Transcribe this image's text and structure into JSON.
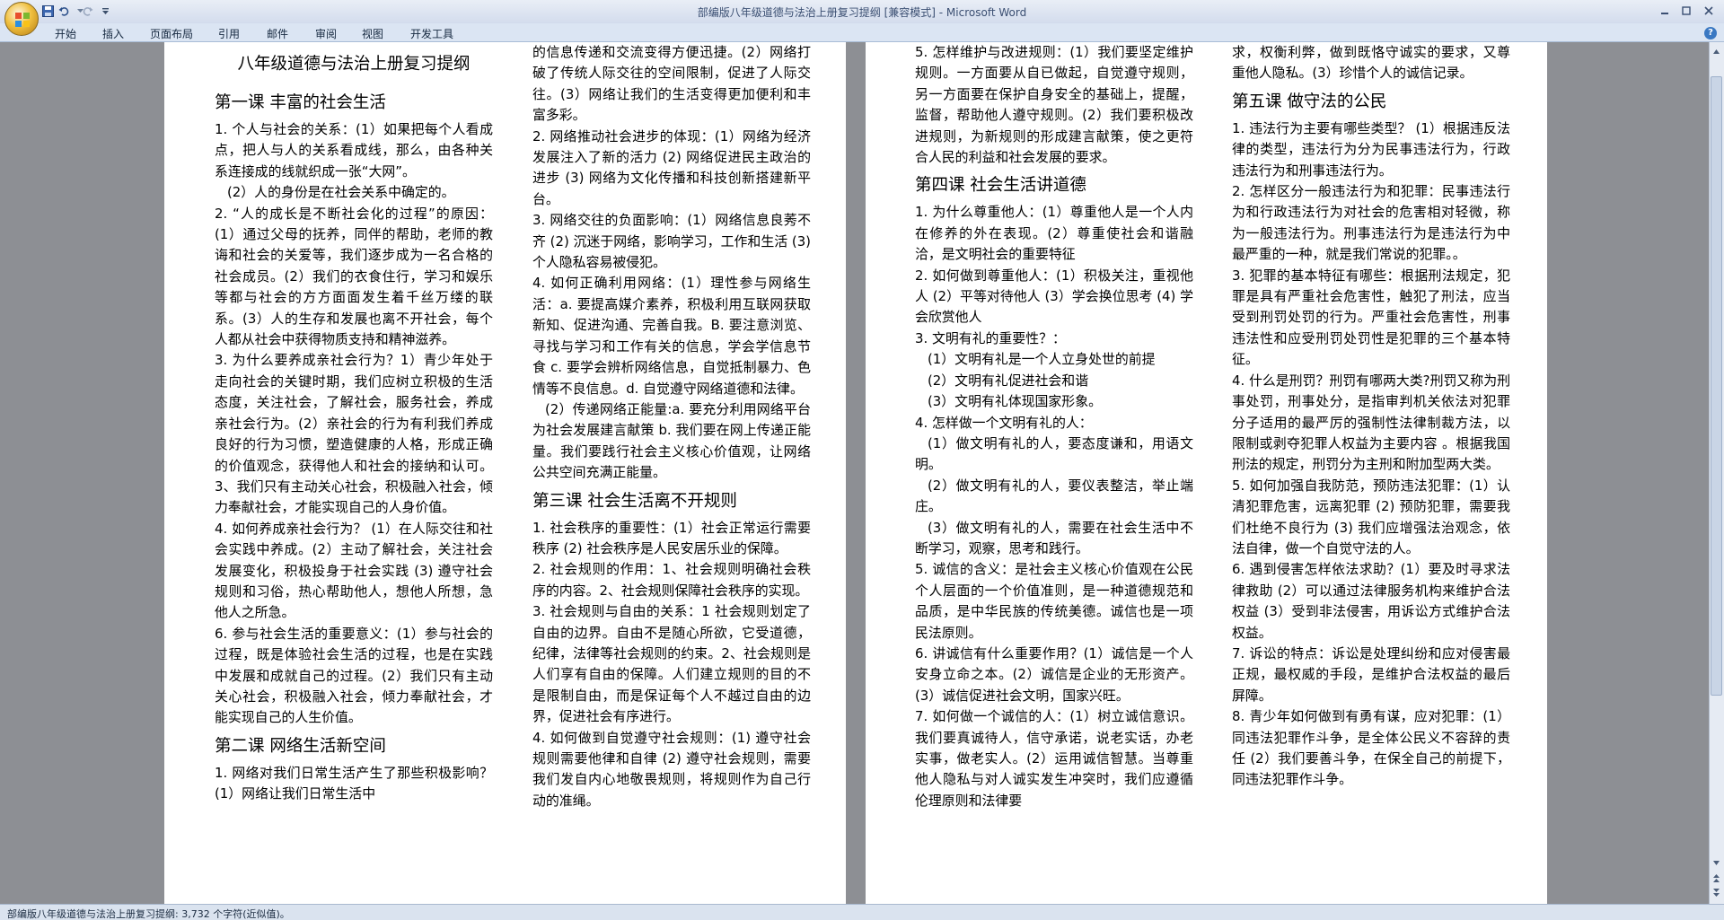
{
  "window": {
    "title": "部编版八年级道德与法治上册复习提纲 [兼容模式] - Microsoft Word"
  },
  "ribbon": {
    "tabs": [
      "开始",
      "插入",
      "页面布局",
      "引用",
      "邮件",
      "审阅",
      "视图",
      "开发工具"
    ]
  },
  "status": {
    "text": "部编版八年级道德与法治上册复习提纲: 3,732 个字符(近似值)。"
  },
  "icons": {
    "office": "office-button-icon",
    "save": "save-icon",
    "undo": "undo-icon",
    "redo": "redo-icon",
    "customize": "customize-qat-icon",
    "minimize": "minimize-icon",
    "maximize": "maximize-icon",
    "close": "close-icon",
    "help": "help-icon"
  },
  "doc": {
    "col1": [
      {
        "t": "title",
        "text": "八年级道德与法治上册复习提纲"
      },
      {
        "t": "h",
        "text": "第一课 丰富的社会生活"
      },
      {
        "t": "p",
        "text": "1.  个人与社会的关系：(1）如果把每个人看成点，把人与人的关系看成线，那么，由各种关系连接成的线就织成一张“大网”。"
      },
      {
        "t": "p",
        "ind": true,
        "text": "(2）人的身份是在社会关系中确定的。"
      },
      {
        "t": "p",
        "text": "2.  “人的成长是不断社会化的过程”的原因：(1）通过父母的抚养，同伴的帮助，老师的教诲和社会的关爱等，我们逐步成为一名合格的社会成员。(2）我们的衣食住行，学习和娱乐等都与社会的方方面面发生着千丝万缕的联系。(3）人的生存和发展也离不开社会，每个人都从社会中获得物质支持和精神滋养。"
      },
      {
        "t": "p",
        "text": "3.  为什么要养成亲社会行为？1）青少年处于走向社会的关键时期，我们应树立积极的生活态度，关注社会，了解社会，服务社会，养成亲社会行为。(2）亲社会的行为有利我们养成良好的行为习惯，塑造健康的人格，形成正确的价值观念，获得他人和社会的接纳和认可。3、我们只有主动关心社会，积极融入社会，倾力奉献社会，才能实现自己的人身价值。"
      },
      {
        "t": "p",
        "text": "4.  如何养成亲社会行为？ (1）在人际交往和社会实践中养成。(2）主动了解社会，关注社会发展变化，积极投身于社会实践 (3) 遵守社会规则和习俗，热心帮助他人，想他人所想，急他人之所急。"
      },
      {
        "t": "p",
        "text": "6. 参与社会生活的重要意义：(1）参与社会的过程，既是体验社会生活的过程，也是在实践中发展和成就自己的过程。(2）我们只有主动关心社会，积极融入社会，倾力奉献社会，才能实现自己的人生价值。"
      },
      {
        "t": "h",
        "text": "第二课  网络生活新空间"
      },
      {
        "t": "p",
        "text": "1.  网络对我们日常生活产生了那些积极影响？ (1）网络让我们日常生活中"
      }
    ],
    "col2": [
      {
        "t": "p",
        "text": "的信息传递和交流变得方便迅捷。(2）网络打破了传统人际交往的空间限制，促进了人际交往。(3）网络让我们的生活变得更加便利和丰富多彩。"
      },
      {
        "t": "p",
        "text": "2.  网络推动社会进步的体现：(1）网络为经济发展注入了新的活力 (2) 网络促进民主政治的进步 (3) 网络为文化传播和科技创新搭建新平台。"
      },
      {
        "t": "p",
        "text": "3.  网络交往的负面影响：(1）网络信息良莠不齐 (2) 沉迷于网络，影响学习，工作和生活 (3) 个人隐私容易被侵犯。"
      },
      {
        "t": "p",
        "text": "4.  如何正确利用网络：(1）理性参与网络生活：a.  要提高媒介素养，积极利用互联网获取新知、促进沟通、完善自我。B. 要注意浏览、寻找与学习和工作有关的信息，学会学信息节食   c. 要学会辨析网络信息，自觉抵制暴力、色情等不良信息。d. 自觉遵守网络道德和法律。"
      },
      {
        "t": "p",
        "ind": true,
        "text": "(2）传递网络正能量:a. 要充分利用网络平台为社会发展建言献策 b. 我们要在网上传递正能量。我们要践行社会主义核心价值观，让网络公共空间充满正能量。"
      },
      {
        "t": "h",
        "text": "第三课   社会生活离不开规则"
      },
      {
        "t": "p",
        "text": "1.  社会秩序的重要性：(1）社会正常运行需要秩序 (2) 社会秩序是人民安居乐业的保障。"
      },
      {
        "t": "p",
        "text": "2.  社会规则的作用：1、社会规则明确社会秩序的内容。2、社会规则保障社会秩序的实现。"
      },
      {
        "t": "p",
        "text": "3.  社会规则与自由的关系：1 社会规则划定了自由的边界。自由不是随心所欲，它受道德，纪律，法律等社会规则的约束。2、社会规则是人们享有自由的保障。人们建立规则的目的不是限制自由，而是保证每个人不越过自由的边界，促进社会有序进行。"
      },
      {
        "t": "p",
        "text": "4.  如何做到自觉遵守社会规则：(1) 遵守社会规则需要他律和自律 (2) 遵守社会规则，需要我们发自内心地敬畏规则，将规则作为自己行动的准绳。"
      }
    ],
    "col3": [
      {
        "t": "p",
        "text": "5.  怎样维护与改进规则：(1）我们要坚定维护规则。一方面要从自已做起，自觉遵守规则，另一方面要在保护自身安全的基础上，提醒，监督，帮助他人遵守规则。(2）我们要积极改进规则，为新规则的形成建言献策，使之更符合人民的利益和社会发展的要求。"
      },
      {
        "t": "h",
        "text": "第四课 社会生活讲道德"
      },
      {
        "t": "p",
        "text": "1.  为什么尊重他人：(1）尊重他人是一个人内在修养的外在表现。(2）尊重使社会和谐融洽，是文明社会的重要特征"
      },
      {
        "t": "p",
        "text": "2.  如何做到尊重他人：(1）积极关注，重视他人 (2）平等对待他人 (3）学会换位思考 (4) 学会欣赏他人"
      },
      {
        "t": "p",
        "text": "3.  文明有礼的重要性？："
      },
      {
        "t": "p",
        "ind": true,
        "text": "(1）文明有礼是一个人立身处世的前提"
      },
      {
        "t": "p",
        "ind": true,
        "text": "(2）文明有礼促进社会和谐"
      },
      {
        "t": "p",
        "ind": true,
        "text": "(3）文明有礼体现国家形象。"
      },
      {
        "t": "p",
        "text": "4.  怎样做一个文明有礼的人："
      },
      {
        "t": "p",
        "ind": true,
        "text": "(1）做文明有礼的人，要态度谦和，用语文明。"
      },
      {
        "t": "p",
        "ind": true,
        "text": "(2）做文明有礼的人，要仪表整洁，举止端庄。"
      },
      {
        "t": "p",
        "ind": true,
        "text": "(3）做文明有礼的人，需要在社会生活中不断学习，观察，思考和践行。"
      },
      {
        "t": "p",
        "text": "5.  诚信的含义：是社会主义核心价值观在公民个人层面的一个价值准则，是一种道德规范和品质，是中华民族的传统美德。诚信也是一项民法原则。"
      },
      {
        "t": "p",
        "text": "6.  讲诚信有什么重要作用？(1）诚信是一个人安身立命之本。(2）诚信是企业的无形资产。(3）诚信促进社会文明，国家兴旺。"
      },
      {
        "t": "p",
        "text": "7.  如何做一个诚信的人：(1）树立诚信意识。我们要真诚待人，信守承诺，说老实话，办老实事，做老实人。(2）运用诚信智慧。当尊重他人隐私与对人诚实发生冲突时，我们应遵循伦理原则和法律要"
      }
    ],
    "col4": [
      {
        "t": "p",
        "text": "求，权衡利弊，做到既恪守诚实的要求，又尊重他人隐私。(3）珍惜个人的诚信记录。"
      },
      {
        "t": "h",
        "text": "第五课 做守法的公民"
      },
      {
        "t": "p",
        "text": "1.  违法行为主要有哪些类型？ (1）根据违反法律的类型，违法行为分为民事违法行为，行政违法行为和刑事违法行为。"
      },
      {
        "t": "p",
        "text": "2.  怎样区分一般违法行为和犯罪：民事违法行为和行政违法行为对社会的危害相对轻微，称为一般违法行为。刑事违法行为是违法行为中最严重的一种，就是我们常说的犯罪。。"
      },
      {
        "t": "p",
        "text": "3.  犯罪的基本特征有哪些：根据刑法规定，犯罪是具有严重社会危害性，触犯了刑法，应当受到刑罚处罚的行为。严重社会危害性，刑事违法性和应受刑罚处罚性是犯罪的三个基本特征。"
      },
      {
        "t": "p",
        "text": "4.  什么是刑罚？刑罚有哪两大类?刑罚又称为刑事处罚，刑事处分，是指审判机关依法对犯罪分子适用的最严厉的强制性法律制裁方法，以限制或剥夺犯罪人权益为主要内容 。根据我国刑法的规定，刑罚分为主刑和附加型两大类。"
      },
      {
        "t": "p",
        "text": "5.  如何加强自我防范，预防违法犯罪：(1）认清犯罪危害，远离犯罪 (2) 预防犯罪，需要我们杜绝不良行为 (3) 我们应增强法治观念，依法自律，做一个自觉守法的人。"
      },
      {
        "t": "p",
        "text": "6.  遇到侵害怎样依法求助？(1）要及时寻求法律救助 (2）可以通过法律服务机构来维护合法权益 (3）受到非法侵害，用诉讼方式维护合法权益。"
      },
      {
        "t": "p",
        "text": "7.  诉讼的特点：诉讼是处理纠纷和应对侵害最正规，最权威的手段，是维护合法权益的最后屏障。"
      },
      {
        "t": "p",
        "text": "8.  青少年如何做到有勇有谋，应对犯罪：(1）同违法犯罪作斗争，是全体公民义不容辞的责任 (2）我们要善斗争，在保全自己的前提下，同违法犯罪作斗争。"
      }
    ]
  }
}
